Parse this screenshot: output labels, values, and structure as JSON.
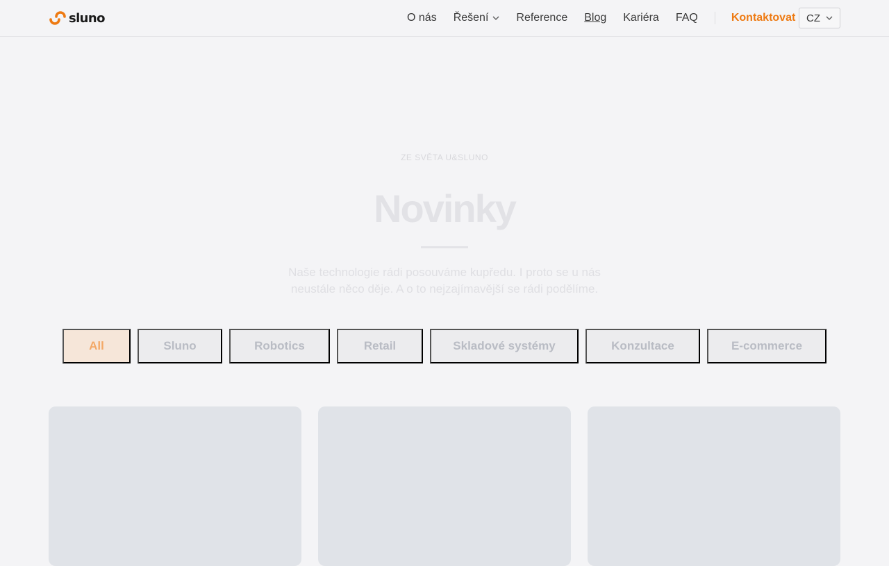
{
  "header": {
    "logo_text": "sluno",
    "nav": [
      {
        "label": "O nás"
      },
      {
        "label": "Řešení",
        "has_dropdown": true
      },
      {
        "label": "Reference"
      },
      {
        "label": "Blog",
        "current": true
      },
      {
        "label": "Kariéra"
      },
      {
        "label": "FAQ"
      }
    ],
    "contact_label": "Kontaktovat",
    "language": "CZ"
  },
  "hero": {
    "eyebrow": "ZE SVĚTA U&SLUNO",
    "title": "Novinky",
    "description": "Naše technologie rádi posouváme kupředu. I proto se u nás neustále něco děje. A o to nejzajímavější se rádi podělíme."
  },
  "filters": [
    {
      "label": "All",
      "active": true
    },
    {
      "label": "Sluno"
    },
    {
      "label": "Robotics"
    },
    {
      "label": "Retail"
    },
    {
      "label": "Skladové systémy"
    },
    {
      "label": "Konzultace"
    },
    {
      "label": "E-commerce"
    }
  ],
  "colors": {
    "accent": "#ee7a12",
    "background": "#f4f4f6",
    "card_placeholder": "#e0e3e8"
  }
}
